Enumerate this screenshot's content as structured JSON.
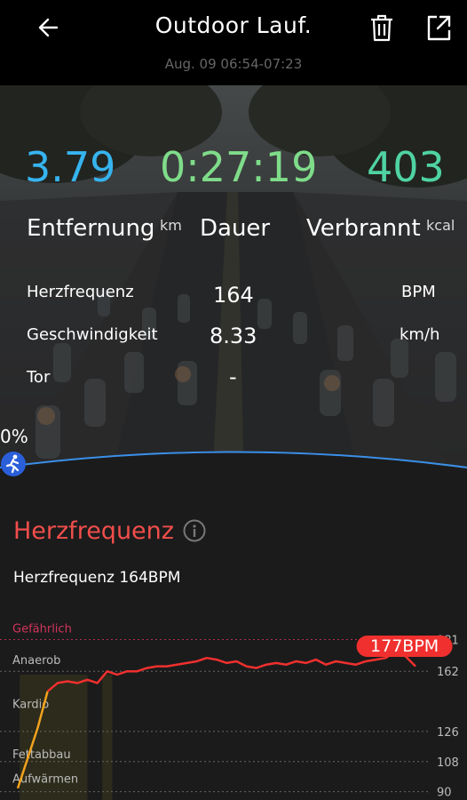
{
  "header": {
    "title": "Outdoor Lauf.",
    "subtitle": "Aug. 09 06:54-07:23"
  },
  "stats": {
    "distance_value": "3.79",
    "distance_label": "Entfernung",
    "distance_unit": "km",
    "duration_value": "0:27:19",
    "duration_label": "Dauer",
    "calories_value": "403",
    "calories_label": "Verbrannt",
    "calories_unit": "kcal"
  },
  "details": {
    "hr_label": "Herzfrequenz",
    "hr_value": "164",
    "hr_unit": "BPM",
    "speed_label": "Geschwindigkeit",
    "speed_value": "8.33",
    "speed_unit": "km/h",
    "goal_label": "Tor",
    "goal_value": "-"
  },
  "progress": {
    "percent_text": "0%",
    "percent": 0
  },
  "heart_section": {
    "title": "Herzfrequenz",
    "summary": "Herzfrequenz 164BPM",
    "max_badge": "177BPM"
  },
  "colors": {
    "distance": "#36b4ef",
    "duration": "#7fdc8a",
    "calories": "#4fd3a4",
    "accent_red": "#f04e4b",
    "progress_blue": "#2b5fd9"
  },
  "chart_data": {
    "type": "line",
    "zones": [
      {
        "name": "Gefährlich",
        "threshold": null
      },
      {
        "name": "Anaerob",
        "threshold": 162
      },
      {
        "name": "Kardio",
        "threshold": 126
      },
      {
        "name": "Fettabbau",
        "threshold": 108
      },
      {
        "name": "Aufwärmen",
        "threshold": 90
      }
    ],
    "y_ticks": [
      181,
      162,
      126,
      108,
      90
    ],
    "ylim": [
      85,
      185
    ],
    "x": [
      0,
      1,
      2,
      3,
      4,
      5,
      6,
      7,
      8,
      9,
      10,
      11,
      12,
      13,
      14,
      15,
      16,
      17,
      18,
      19,
      20,
      21,
      22,
      23,
      24,
      25,
      26,
      27,
      28,
      29,
      30,
      31,
      32,
      33,
      34,
      35,
      36,
      37,
      38,
      39,
      40
    ],
    "values": [
      92,
      110,
      128,
      150,
      155,
      156,
      155,
      157,
      155,
      162,
      160,
      162,
      162,
      164,
      165,
      165,
      166,
      167,
      168,
      170,
      169,
      167,
      168,
      165,
      164,
      166,
      167,
      166,
      168,
      167,
      169,
      166,
      168,
      167,
      166,
      168,
      169,
      170,
      174,
      171,
      165
    ],
    "max_value": 177,
    "max_label": "177BPM"
  }
}
